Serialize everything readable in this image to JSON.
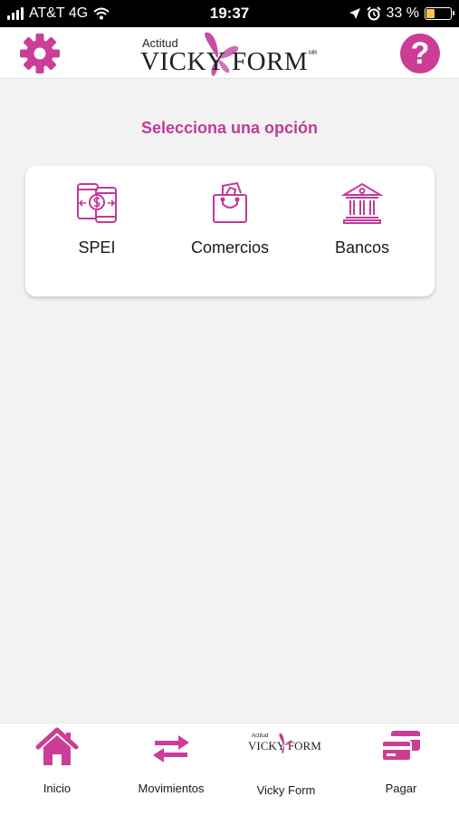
{
  "status_bar": {
    "carrier": "AT&T 4G",
    "time": "19:37",
    "battery": "33 %",
    "battery_level": 0.33,
    "icons": [
      "signal-icon",
      "wifi-icon",
      "location-icon",
      "alarm-icon",
      "battery-icon"
    ]
  },
  "header": {
    "logo_small": "Actitud",
    "logo_big": "VICKY FORM",
    "logo_mark": "MR",
    "help_label": "?"
  },
  "main": {
    "title": "Selecciona una opción",
    "options": [
      {
        "label": "SPEI",
        "icon": "phone-transfer-icon"
      },
      {
        "label": "Comercios",
        "icon": "shopping-bag-icon"
      },
      {
        "label": "Bancos",
        "icon": "bank-icon"
      }
    ]
  },
  "bottom_nav": {
    "items": [
      {
        "label": "Inicio",
        "icon": "home-icon"
      },
      {
        "label": "Movimientos",
        "icon": "transfer-arrows-icon"
      },
      {
        "label": "Vicky Form",
        "icon": "vicky-form-logo-icon"
      },
      {
        "label": "Pagar",
        "icon": "credit-cards-icon"
      }
    ],
    "logo_small": "Actitud",
    "logo_big": "VICKY FORM"
  },
  "colors": {
    "accent": "#c2399a",
    "accent_alt": "#cc3d97",
    "background": "#f2f2f2",
    "battery": "#f2c94c"
  }
}
